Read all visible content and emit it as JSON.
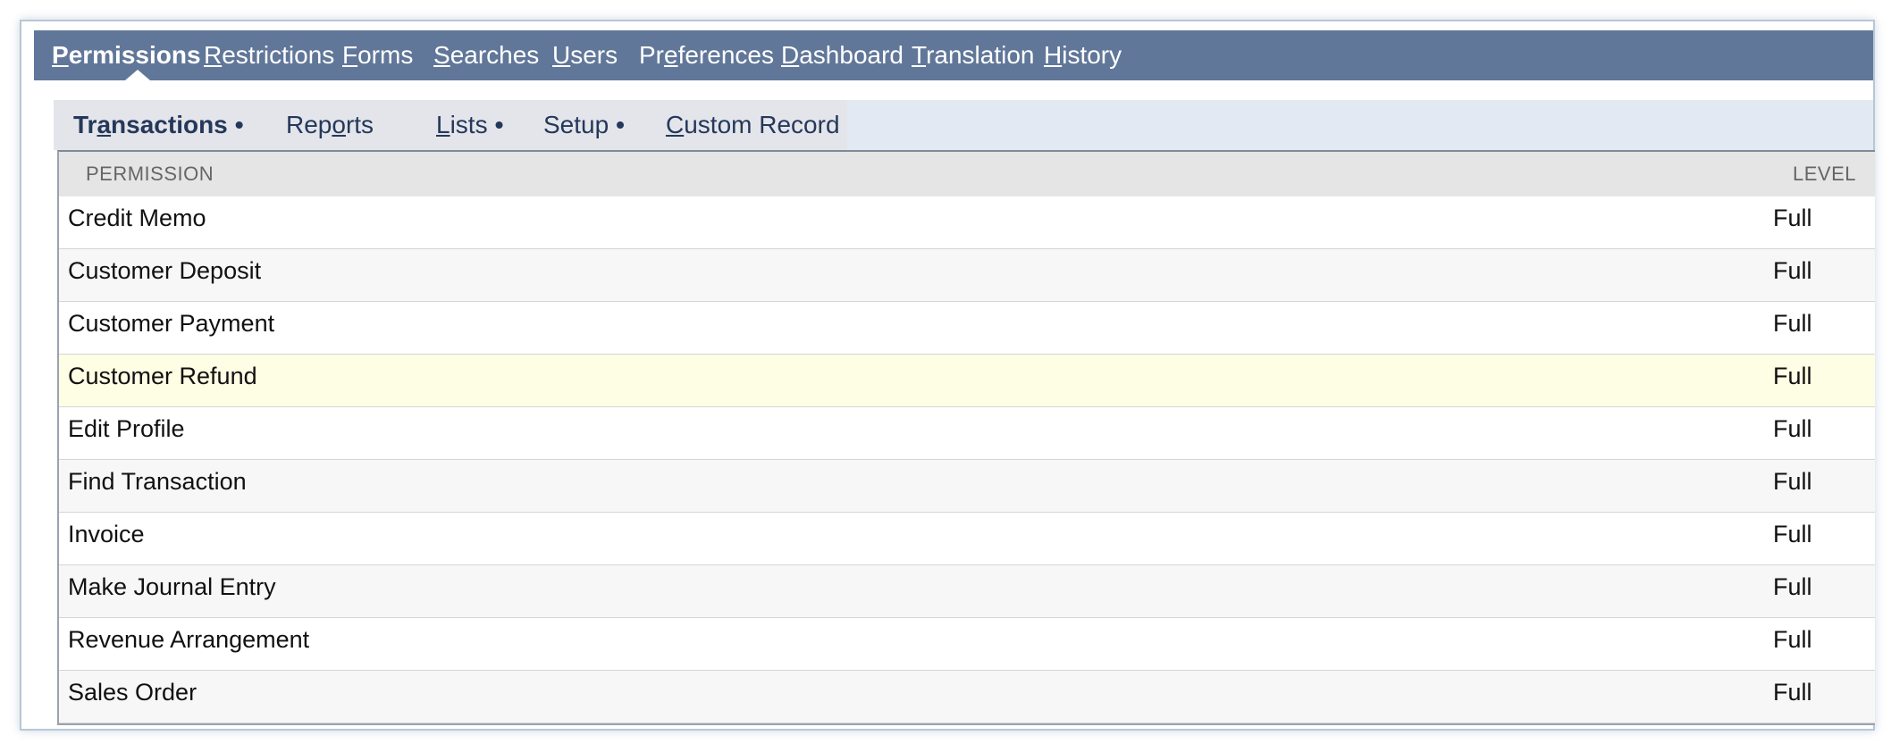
{
  "topnav": {
    "tabs": [
      {
        "first": "P",
        "rest": "ermissions",
        "active": true
      },
      {
        "first": "R",
        "rest": "estrictions"
      },
      {
        "first": "F",
        "rest": "orms"
      },
      {
        "first": "S",
        "rest": "earches"
      },
      {
        "first": "U",
        "rest": "sers"
      },
      {
        "pre": "Pr",
        "first": "e",
        "rest": "ferences"
      },
      {
        "first": "D",
        "rest": "ashboard"
      },
      {
        "first": "T",
        "rest": "ranslation"
      },
      {
        "first": "H",
        "rest": "istory"
      }
    ]
  },
  "subnav": {
    "tabs": [
      {
        "pre": "Tr",
        "first": "a",
        "rest": "nsactions",
        "dot": "•",
        "active": true
      },
      {
        "pre": "Rep",
        "first": "o",
        "rest": "rts",
        "dot": ""
      },
      {
        "pre": "",
        "first": "L",
        "rest": "ists",
        "dot": "•"
      },
      {
        "pre": "",
        "first": "",
        "rest": "Setup",
        "dot": "•"
      },
      {
        "pre": "",
        "first": "C",
        "rest": "ustom Record",
        "dot": ""
      }
    ]
  },
  "table": {
    "headers": {
      "permission": "PERMISSION",
      "level": "LEVEL"
    },
    "rows": [
      {
        "permission": "Credit Memo",
        "level": "Full"
      },
      {
        "permission": "Customer Deposit",
        "level": "Full"
      },
      {
        "permission": "Customer Payment",
        "level": "Full"
      },
      {
        "permission": "Customer Refund",
        "level": "Full"
      },
      {
        "permission": "Edit Profile",
        "level": "Full"
      },
      {
        "permission": "Find Transaction",
        "level": "Full"
      },
      {
        "permission": "Invoice",
        "level": "Full"
      },
      {
        "permission": "Make Journal Entry",
        "level": "Full"
      },
      {
        "permission": "Revenue Arrangement",
        "level": "Full"
      },
      {
        "permission": "Sales Order",
        "level": "Full"
      }
    ]
  },
  "colors": {
    "topnav_bg": "#617799",
    "subnav_bg": "#e3e9f2",
    "highlight_row": "#fdfee3",
    "header_bg": "#e5e5e5"
  }
}
